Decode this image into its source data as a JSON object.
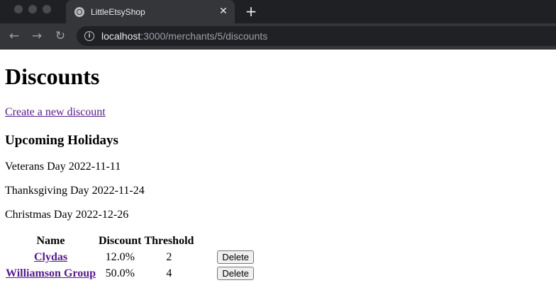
{
  "browser": {
    "tab_title": "LittleEtsyShop",
    "close_glyph": "✕",
    "new_tab_glyph": "+",
    "back_glyph": "←",
    "forward_glyph": "→",
    "reload_glyph": "↻",
    "url_host": "localhost",
    "url_path": ":3000/merchants/5/discounts"
  },
  "page": {
    "title": "Discounts",
    "create_link": "Create a new discount",
    "holidays_heading": "Upcoming Holidays",
    "holidays": [
      "Veterans Day 2022-11-11",
      "Thanksgiving Day 2022-11-24",
      "Christmas Day 2022-12-26"
    ],
    "table": {
      "headers": [
        "Name",
        "Discount",
        "Threshold"
      ],
      "rows": [
        {
          "name": "Clydas",
          "discount": "12.0%",
          "threshold": "2",
          "action": "Delete"
        },
        {
          "name": "Williamson Group",
          "discount": "50.0%",
          "threshold": "4",
          "action": "Delete"
        }
      ]
    }
  },
  "colors": {
    "link": "#551a8b",
    "chrome_dark": "#1f2023",
    "chrome_tab": "#35363a"
  }
}
